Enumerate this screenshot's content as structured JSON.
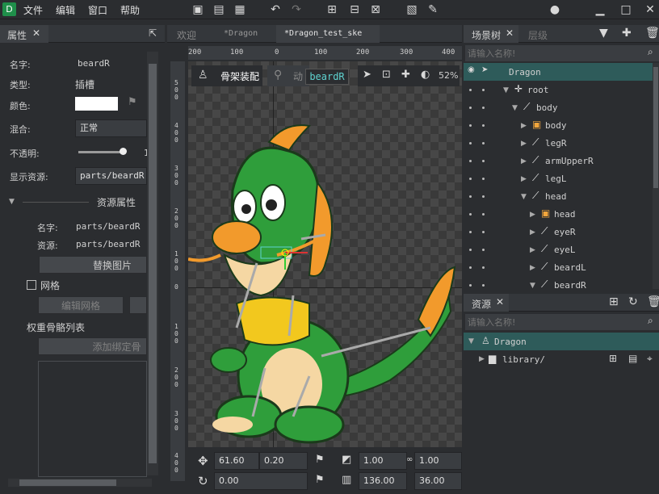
{
  "menu": {
    "file": "文件",
    "edit": "编辑",
    "window": "窗口",
    "help": "帮助"
  },
  "tabs_left": {
    "properties": "属性"
  },
  "properties": {
    "name_label": "名字:",
    "name_value": "beardR",
    "type_label": "类型:",
    "type_value": "插槽",
    "color_label": "颜色:",
    "blend_label": "混合:",
    "blend_value": "正常",
    "opacity_label": "不透明:",
    "opacity_value": "1",
    "display_label": "显示资源:",
    "display_value": "parts/beardR",
    "res_section": "资源属性",
    "res_name_label": "名字:",
    "res_name_value": "parts/beardR",
    "res_src_label": "资源:",
    "res_src_value": "parts/beardR",
    "replace_btn": "替换图片",
    "mesh_label": "网格",
    "edit_mesh_btn": "编辑网格",
    "weight_label": "权重骨骼列表",
    "add_bind_btn": "添加绑定骨"
  },
  "editor_tabs": [
    "欢迎",
    "*Dragon",
    "*Dragon_test_ske"
  ],
  "ruler": [
    "200",
    "100",
    "0",
    "100",
    "200",
    "300",
    "400"
  ],
  "vruler": [
    "5\n0\n0",
    "4\n0\n0",
    "3\n0\n0",
    "2\n0\n0",
    "1\n0\n0",
    "0",
    "1\n0\n0",
    "2\n0\n0",
    "3\n0\n0",
    "4\n0\n0"
  ],
  "mode": {
    "rig": "骨架装配",
    "anim": "动",
    "tooltip": "beardR",
    "zoom": "52%"
  },
  "transform": {
    "x": "61.60",
    "y": "0.20",
    "scale_x": "1.00",
    "scale_y": "1.00",
    "rot": "0.00",
    "w": "136.00",
    "h": "36.00"
  },
  "scene_tabs": {
    "scene_tree": "场景树",
    "layers": "层级"
  },
  "scene_search_placeholder": "请输入名称!",
  "tree": [
    {
      "label": "Dragon",
      "depth": 0,
      "kind": "armature"
    },
    {
      "label": "root",
      "depth": 1,
      "kind": "root"
    },
    {
      "label": "body",
      "depth": 2,
      "kind": "bone"
    },
    {
      "label": "body",
      "depth": 3,
      "kind": "slot"
    },
    {
      "label": "legR",
      "depth": 3,
      "kind": "bone"
    },
    {
      "label": "armUpperR",
      "depth": 3,
      "kind": "bone"
    },
    {
      "label": "legL",
      "depth": 3,
      "kind": "bone"
    },
    {
      "label": "head",
      "depth": 3,
      "kind": "bone"
    },
    {
      "label": "head",
      "depth": 4,
      "kind": "slot"
    },
    {
      "label": "eyeR",
      "depth": 4,
      "kind": "bone"
    },
    {
      "label": "eyeL",
      "depth": 4,
      "kind": "bone"
    },
    {
      "label": "beardL",
      "depth": 4,
      "kind": "bone"
    },
    {
      "label": "beardR",
      "depth": 4,
      "kind": "bone"
    }
  ],
  "assets_tab": "资源",
  "assets_search_placeholder": "请输入名称!",
  "assets": [
    {
      "label": "Dragon"
    },
    {
      "label": "library/"
    }
  ],
  "colors": {
    "accent": "#2e5b5a",
    "select": "#3a6e6c",
    "bg": "#2b2d30"
  }
}
